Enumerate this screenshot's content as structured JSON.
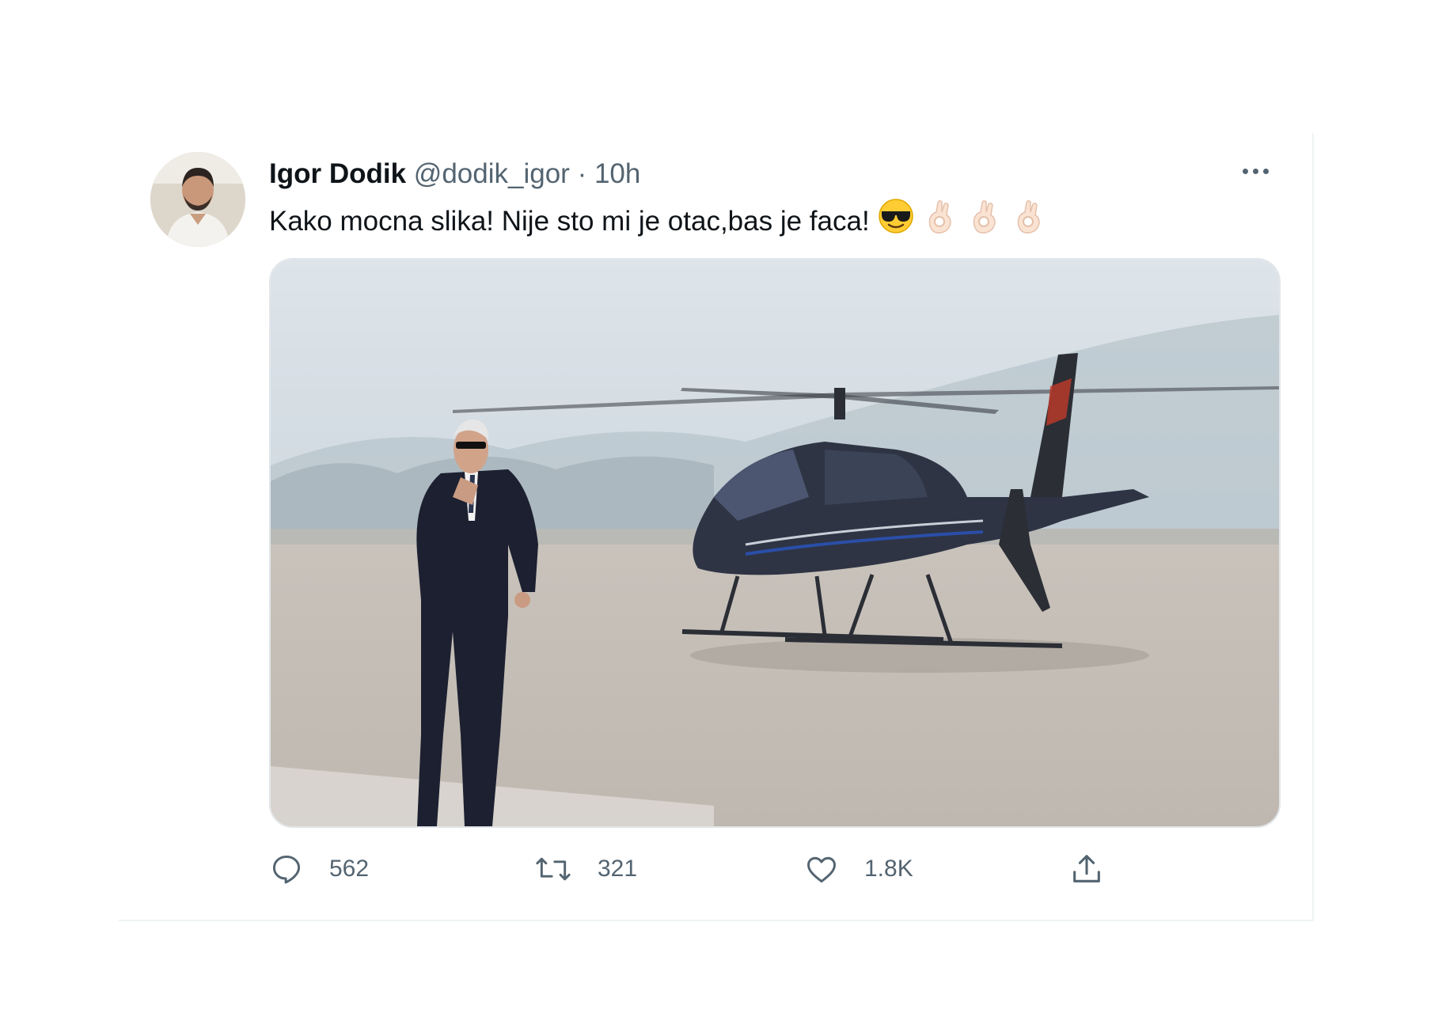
{
  "tweet": {
    "author_name": "Igor Dodik",
    "handle": "@dodik_igor",
    "separator": "·",
    "time": "10h",
    "text": "Kako mocna slika! Nije sto mi je otac,bas je faca!",
    "emojis": [
      "sunglasses-face",
      "ok-hand",
      "ok-hand",
      "ok-hand"
    ],
    "media_alt": "Man in dark suit and sunglasses walking on tarmac in front of a dark helicopter"
  },
  "actions": {
    "replies": "562",
    "retweets": "321",
    "likes": "1.8K"
  },
  "colors": {
    "text_primary": "#0f1419",
    "text_secondary": "#536471",
    "border": "#eff3f4"
  }
}
